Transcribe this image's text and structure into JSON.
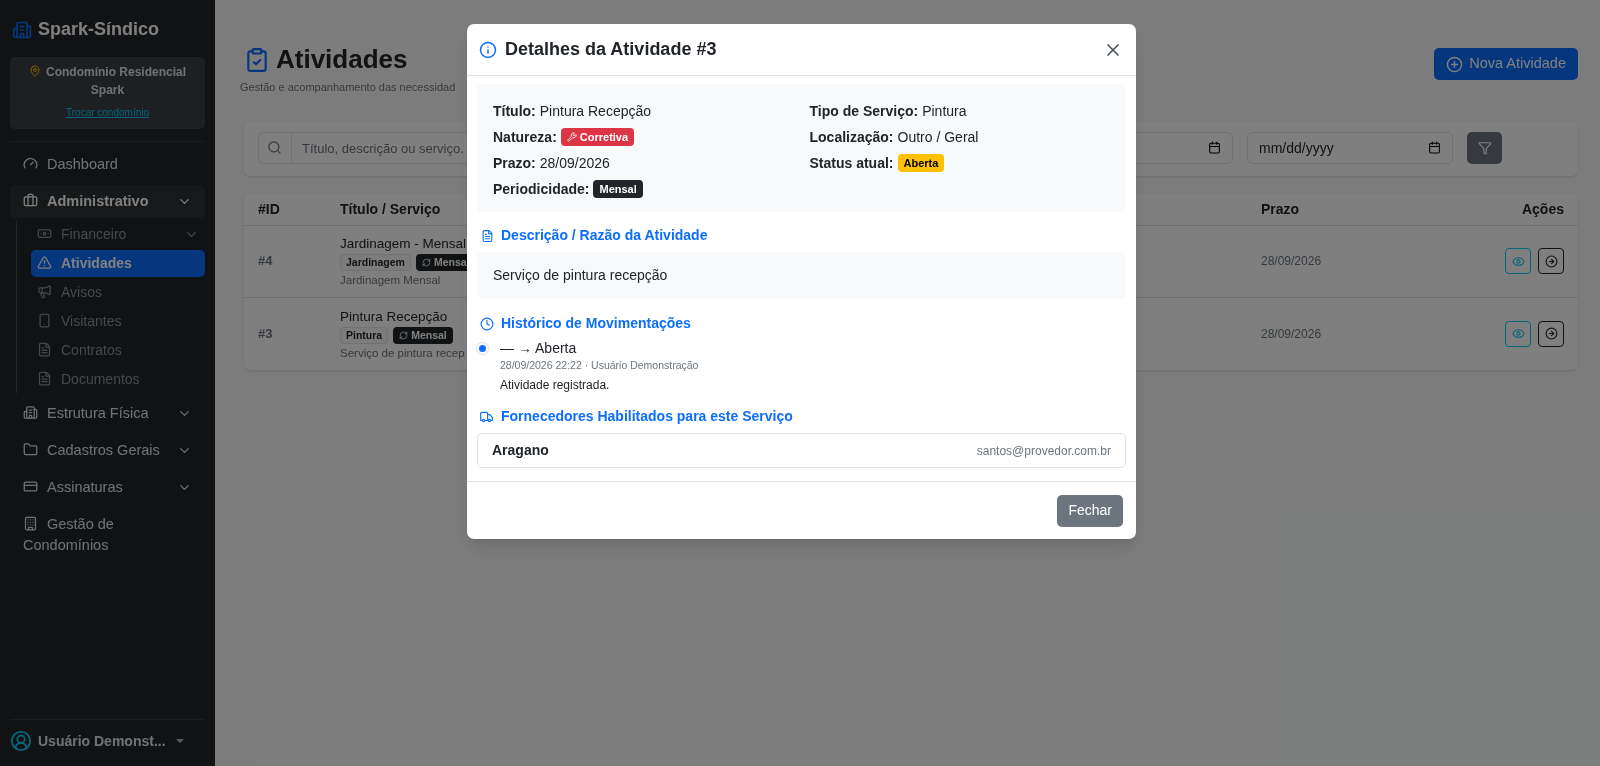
{
  "sidebar": {
    "brand": "Spark-Síndico",
    "condo": {
      "name": "Condomínio Residencial Spark",
      "link": "Trocar condomínio"
    },
    "items": [
      {
        "label": "Dashboard",
        "kind": "link"
      },
      {
        "label": "Administrativo",
        "kind": "group",
        "expanded": true,
        "children": [
          {
            "label": "Financeiro",
            "kind": "group",
            "expanded": false,
            "selected": false
          },
          {
            "label": "Atividades",
            "kind": "link",
            "selected": true
          },
          {
            "label": "Avisos",
            "kind": "link",
            "selected": false
          },
          {
            "label": "Visitantes",
            "kind": "link",
            "selected": false
          },
          {
            "label": "Contratos",
            "kind": "link",
            "selected": false
          },
          {
            "label": "Documentos",
            "kind": "link",
            "selected": false
          }
        ]
      },
      {
        "label": "Estrutura Física",
        "kind": "group",
        "expanded": false
      },
      {
        "label": "Cadastros Gerais",
        "kind": "group",
        "expanded": false
      },
      {
        "label": "Assinaturas",
        "kind": "group",
        "expanded": false
      },
      {
        "label": "Gestão de Condomínios",
        "kind": "link"
      }
    ],
    "user": "Usuário Demonst..."
  },
  "page": {
    "title": "Atividades",
    "subtitle": "Gestão e acompanhamento das necessidad",
    "new_button": "Nova Atividade"
  },
  "filters": {
    "search_placeholder": "Título, descrição ou serviço.",
    "date_placeholder": "mm/dd/yyyy"
  },
  "table": {
    "columns": [
      "#ID",
      "Título / Serviço",
      "Prazo",
      "Ações"
    ],
    "rows": [
      {
        "id": "#4",
        "title": "Jardinagem - Mensal",
        "tags": [
          {
            "label": "Jardinagem",
            "kind": "service"
          },
          {
            "label": "Mensa",
            "kind": "period"
          }
        ],
        "description": "Jardinagem Mensal",
        "deadline": "28/09/2026"
      },
      {
        "id": "#3",
        "title": "Pintura Recepção",
        "tags": [
          {
            "label": "Pintura",
            "kind": "service"
          },
          {
            "label": "Mensal",
            "kind": "period"
          }
        ],
        "description": "Serviço de pintura recep",
        "deadline": "28/09/2026"
      }
    ]
  },
  "modal": {
    "title": "Detalhes da Atividade #3",
    "fields_left": [
      {
        "label": "Título:",
        "kind": "text",
        "value": "Pintura Recepção"
      },
      {
        "label": "Natureza:",
        "kind": "badge",
        "value": "Corretiva",
        "color": "#dc3545",
        "icon": true
      },
      {
        "label": "Prazo:",
        "kind": "text",
        "value": "28/09/2026"
      },
      {
        "label": "Periodicidade:",
        "kind": "badge",
        "value": "Mensal",
        "color": "#212529",
        "icon": false
      }
    ],
    "fields_right": [
      {
        "label": "Tipo de Serviço:",
        "kind": "text",
        "value": "Pintura"
      },
      {
        "label": "Localização:",
        "kind": "text",
        "value": "Outro / Geral"
      },
      {
        "label": "Status atual:",
        "kind": "badge",
        "value": "Aberta",
        "color": "#ffc107",
        "icon": false
      }
    ],
    "description_heading": "Descrição / Razão da Atividade",
    "description": "Serviço de pintura recepção",
    "history_heading": "Histórico de Movimentações",
    "history": [
      {
        "change": "— → Aberta",
        "meta": "28/09/2026 22:22 · Usuário Demonstração",
        "note": "Atividade registrada."
      }
    ],
    "suppliers_heading": "Fornecedores Habilitados para este Serviço",
    "suppliers": [
      {
        "name": "Aragano",
        "email": "santos@provedor.com.br"
      }
    ],
    "close_button": "Fechar"
  }
}
